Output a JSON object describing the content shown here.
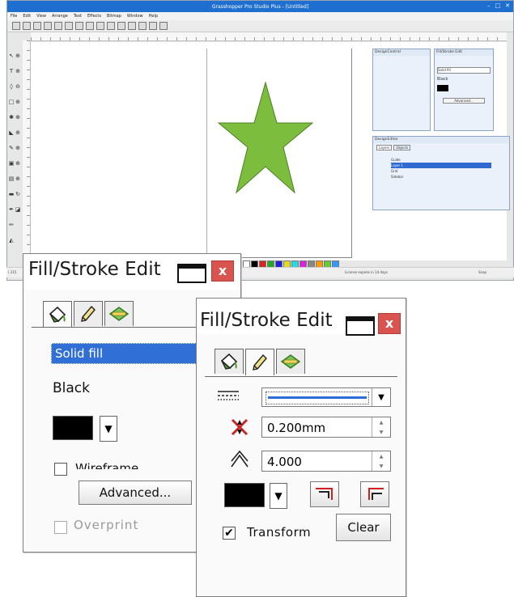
{
  "app": {
    "title": "Grasshopper Pro Studio Plus - [Untitled]",
    "menu": [
      "File",
      "Edit",
      "View",
      "Arrange",
      "Text",
      "Effects",
      "Bitmap",
      "Window",
      "Help"
    ],
    "status_left": "( 215",
    "status_center": "License expires in 14 days",
    "status_right": "Snap"
  },
  "mini_panels": {
    "design_central": "DesignCentral",
    "fill_stroke": "Fill/Stroke Edit",
    "fill_value": "Solid fill",
    "color_value": "Black",
    "advanced": "Advanced...",
    "design_editor": "DesignEditor",
    "design_editor_tabs": [
      "Layers",
      "Objects"
    ],
    "layers": [
      "Guide",
      "Layer 1",
      "Grid",
      "Sidebar"
    ]
  },
  "dialog_fill": {
    "title": "Fill/Stroke Edit",
    "close_label": "x",
    "fill_type": "Solid fill",
    "color_name": "Black",
    "wireframe_label": "Wireframe",
    "advanced_label": "Advanced...",
    "overprint_label": "Overprint"
  },
  "dialog_stroke": {
    "title": "Fill/Stroke Edit",
    "close_label": "x",
    "width_value": "0.200mm",
    "miter_value": "4.000",
    "transform_label": "Transform",
    "clear_label": "Clear",
    "transform_checked": "✔"
  },
  "colors": {
    "star_fill": "#7cbd3e",
    "star_stroke": "#4e7f22",
    "close_button": "#d9534f",
    "line_style": "#2b6fd6",
    "accent_red": "#cc2222"
  }
}
